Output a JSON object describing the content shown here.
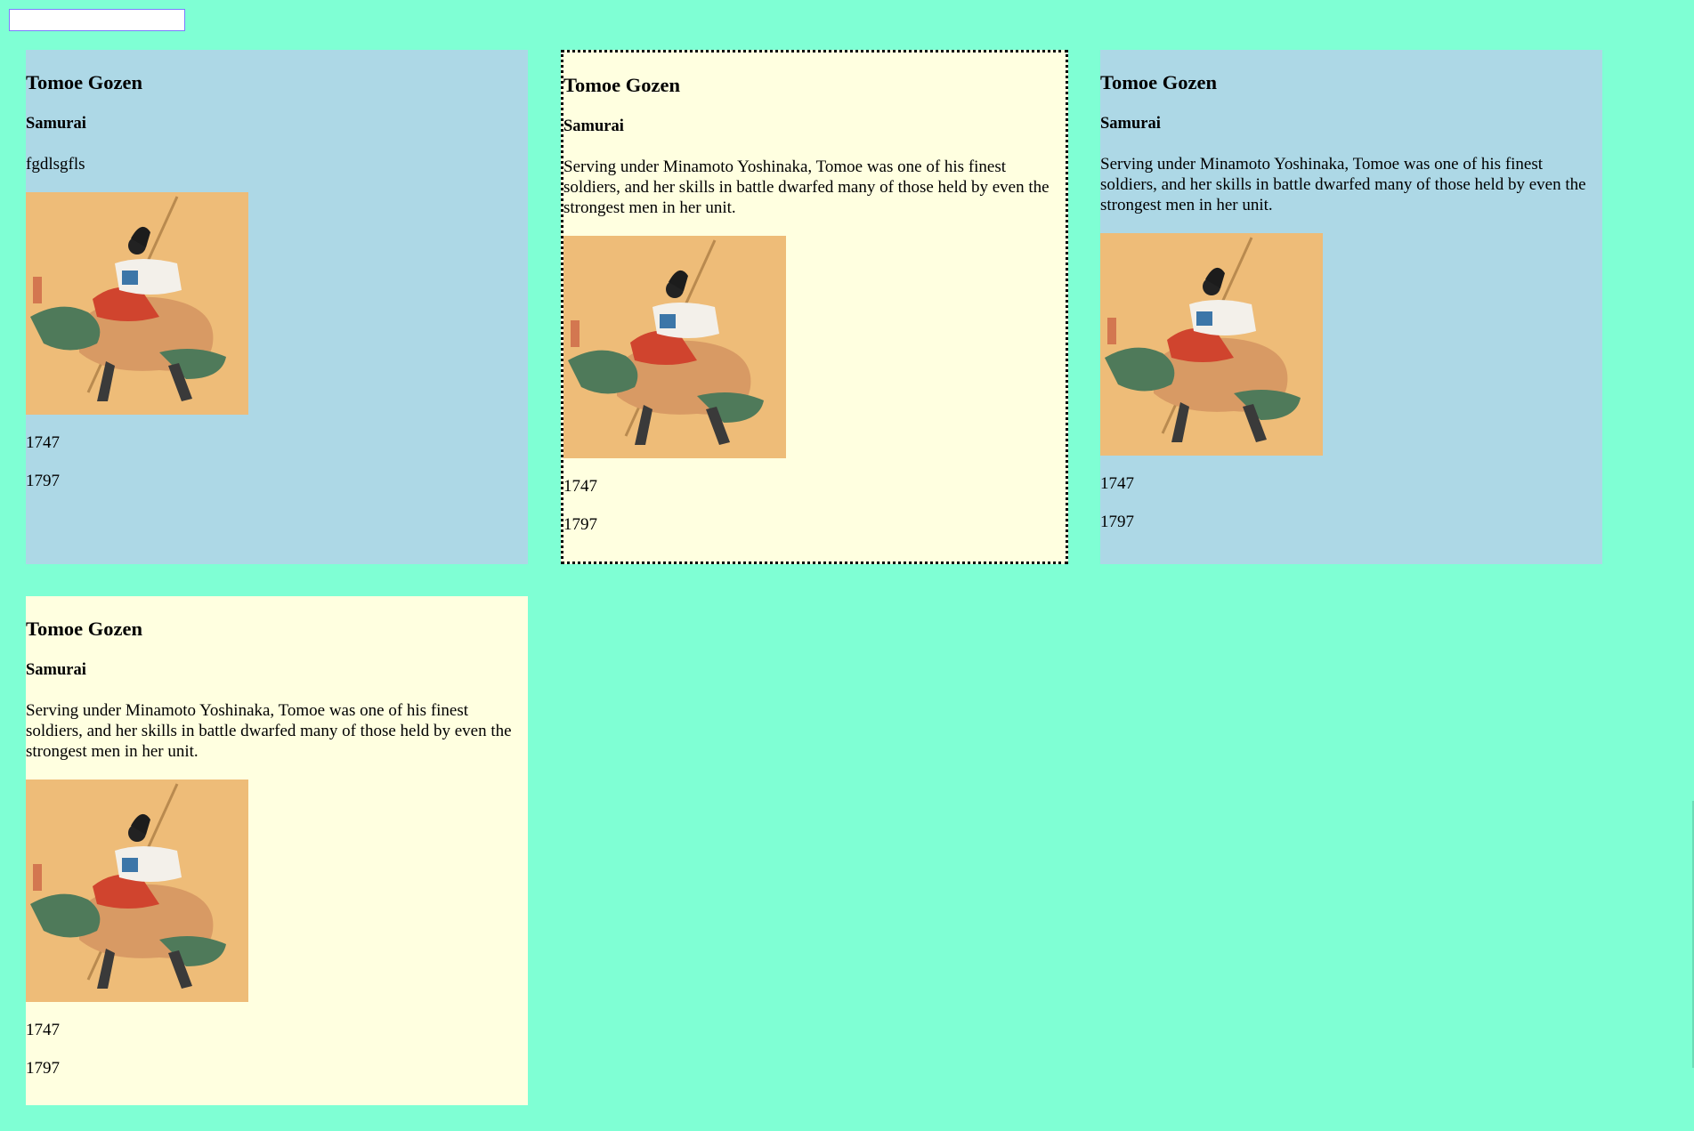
{
  "search": {
    "value": "",
    "placeholder": ""
  },
  "cards": [
    {
      "title": "Tomoe Gozen",
      "subtitle": "Samurai",
      "description": "fgdlsgfls",
      "year_start": "1747",
      "year_end": "1797",
      "bg_color": "#add8e6"
    },
    {
      "title": "Tomoe Gozen",
      "subtitle": "Samurai",
      "description": "Serving under Minamoto Yoshinaka, Tomoe was one of his finest soldiers, and her skills in battle dwarfed many of those held by even the strongest men in her unit.",
      "year_start": "1747",
      "year_end": "1797",
      "bg_color": "#ffffe0"
    },
    {
      "title": "Tomoe Gozen",
      "subtitle": "Samurai",
      "description": "Serving under Minamoto Yoshinaka, Tomoe was one of his finest soldiers, and her skills in battle dwarfed many of those held by even the strongest men in her unit.",
      "year_start": "1747",
      "year_end": "1797",
      "bg_color": "#add8e6"
    },
    {
      "title": "Tomoe Gozen",
      "subtitle": "Samurai",
      "description": "Serving under Minamoto Yoshinaka, Tomoe was one of his finest soldiers, and her skills in battle dwarfed many of those held by even the strongest men in her unit.",
      "year_start": "1747",
      "year_end": "1797",
      "bg_color": "#ffffe0"
    }
  ],
  "page_bg_color": "#7fffd4",
  "selected_border_color": "#000000"
}
